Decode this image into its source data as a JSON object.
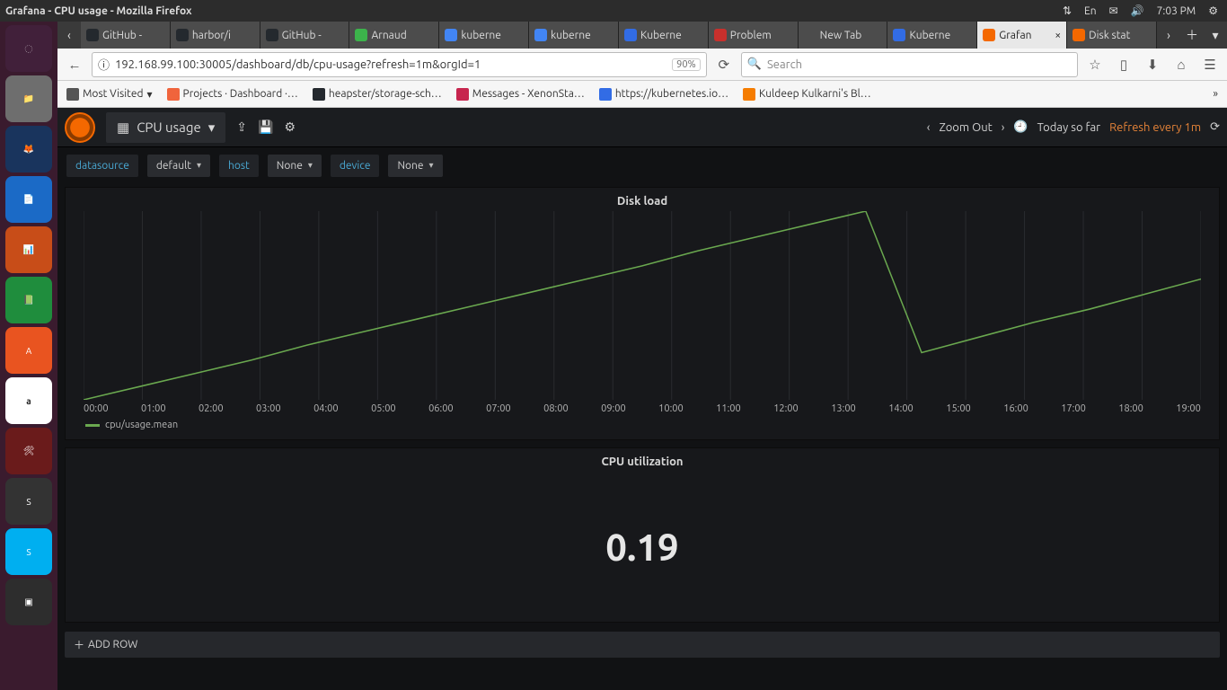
{
  "system": {
    "window_title": "Grafana - CPU usage - Mozilla Firefox",
    "lang": "En",
    "time": "7:03 PM"
  },
  "browser": {
    "tabs": [
      {
        "label": "GitHub -",
        "fav": "#24292e"
      },
      {
        "label": "harbor/i",
        "fav": "#24292e"
      },
      {
        "label": "GitHub -",
        "fav": "#24292e"
      },
      {
        "label": "Arnaud",
        "fav": "#3cb44b"
      },
      {
        "label": "kuberne",
        "fav": "#4285f4"
      },
      {
        "label": "kuberne",
        "fav": "#4285f4"
      },
      {
        "label": "Kuberne",
        "fav": "#326ce5"
      },
      {
        "label": "Problem",
        "fav": "#c9302c"
      },
      {
        "label": "New Tab",
        "fav": "transparent"
      },
      {
        "label": "Kuberne",
        "fav": "#326ce5"
      },
      {
        "label": "Grafan",
        "fav": "#f46800",
        "active": true,
        "closable": true
      },
      {
        "label": "Disk stat",
        "fav": "#f46800"
      }
    ],
    "url": "192.168.99.100:30005/dashboard/db/cpu-usage?refresh=1m&orgId=1",
    "zoom": "90%",
    "search_placeholder": "Search",
    "bookmarks": [
      {
        "label": "Most Visited",
        "icon": "#555"
      },
      {
        "label": "Projects · Dashboard ·…",
        "icon": "#f0643c"
      },
      {
        "label": "heapster/storage-sch…",
        "icon": "#24292e"
      },
      {
        "label": "Messages - XenonSta…",
        "icon": "#c7254e"
      },
      {
        "label": "https://kubernetes.io…",
        "icon": "#326ce5"
      },
      {
        "label": "Kuldeep Kulkarni's Bl…",
        "icon": "#f57c00"
      }
    ]
  },
  "grafana": {
    "dashboard_name": "CPU usage",
    "zoom_label": "Zoom Out",
    "time_range": "Today so far",
    "refresh": "Refresh every 1m",
    "vars": [
      {
        "label": "datasource",
        "value": "default"
      },
      {
        "label": "host",
        "value": "None"
      },
      {
        "label": "device",
        "value": "None"
      }
    ],
    "panel1": {
      "title": "Disk load",
      "legend": "cpu/usage.mean",
      "x": [
        "00:00",
        "01:00",
        "02:00",
        "03:00",
        "04:00",
        "05:00",
        "06:00",
        "07:00",
        "08:00",
        "09:00",
        "10:00",
        "11:00",
        "12:00",
        "13:00",
        "14:00",
        "15:00",
        "16:00",
        "17:00",
        "18:00",
        "19:00"
      ]
    },
    "panel2": {
      "title": "CPU utilization",
      "value": "0.19"
    },
    "add_row": "ADD ROW"
  },
  "chart_data": {
    "type": "line",
    "title": "Disk load",
    "series": [
      {
        "name": "cpu/usage.mean",
        "x": [
          "00:00",
          "01:00",
          "02:00",
          "03:00",
          "04:00",
          "05:00",
          "06:00",
          "07:00",
          "08:00",
          "09:00",
          "10:00",
          "11:00",
          "12:00",
          "13:00",
          "14:00",
          "14:05",
          "15:00",
          "16:00",
          "17:00",
          "18:00",
          "19:00"
        ],
        "values": [
          0.0,
          0.07,
          0.14,
          0.21,
          0.29,
          0.36,
          0.43,
          0.5,
          0.57,
          0.64,
          0.71,
          0.79,
          0.86,
          0.93,
          1.0,
          0.25,
          0.33,
          0.41,
          0.48,
          0.56,
          0.64
        ]
      }
    ],
    "xlabel": "",
    "ylabel": "",
    "ylim": [
      0,
      1
    ]
  }
}
